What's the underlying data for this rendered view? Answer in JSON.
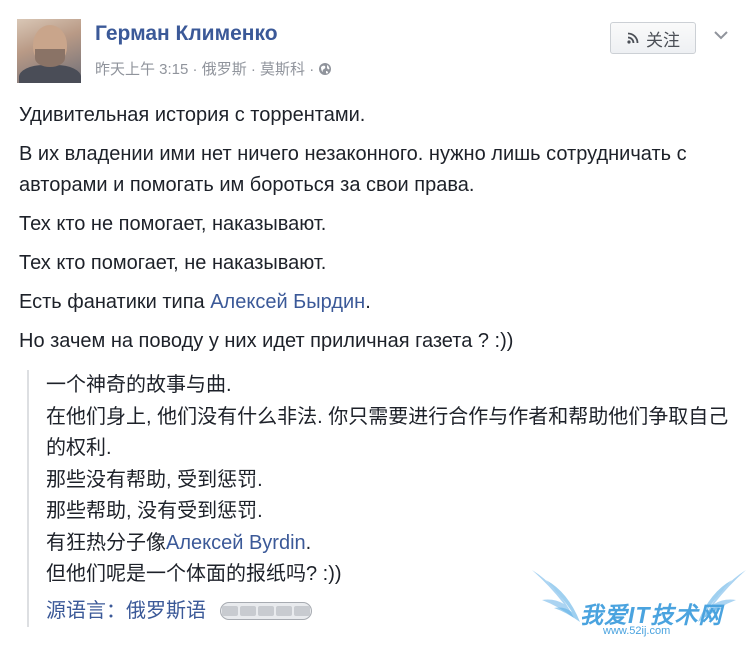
{
  "post": {
    "author": "Герман Клименко",
    "meta": "昨天上午 3:15 · 俄罗斯 · 莫斯科 ·",
    "follow_label": "关注",
    "paragraphs": [
      "Удивительная история с торрентами.",
      "В их владении ими нет ничего незаконного. нужно лишь сотрудничать с авторами и помогать им бороться за свои права.",
      "Тех кто не помогает, наказывают.",
      "Тех кто помогает, не наказывают."
    ],
    "fanatics_prefix": "Есть фанатики типа ",
    "fanatics_link": "Алексей Бырдин",
    "fanatics_suffix": ".",
    "last_paragraph": "Но зачем на поводу у них идет приличная газета ? :))"
  },
  "translation": {
    "lines": [
      "一个神奇的故事与曲.",
      "在他们身上, 他们没有什么非法. 你只需要进行合作与作者和帮助他们争取自己的权利.",
      "那些没有帮助, 受到惩罚.",
      "那些帮助, 没有受到惩罚."
    ],
    "fanatics_prefix": "有狂热分子像",
    "fanatics_link": "Алексей Byrdin",
    "fanatics_suffix": ".",
    "last_line": "但他们呢是一个体面的报纸吗? :))",
    "source_label": "源语言：俄罗斯语"
  },
  "watermark": {
    "text": "我爱IT技术网",
    "url": "www.52ij.com"
  },
  "icons": {
    "globe": "globe-icon",
    "follow": "rss-icon",
    "menu": "chevron-down-icon"
  },
  "colors": {
    "link": "#3b5998",
    "meta": "#90949c",
    "text": "#1d2129",
    "watermark": "#4aa3df"
  }
}
